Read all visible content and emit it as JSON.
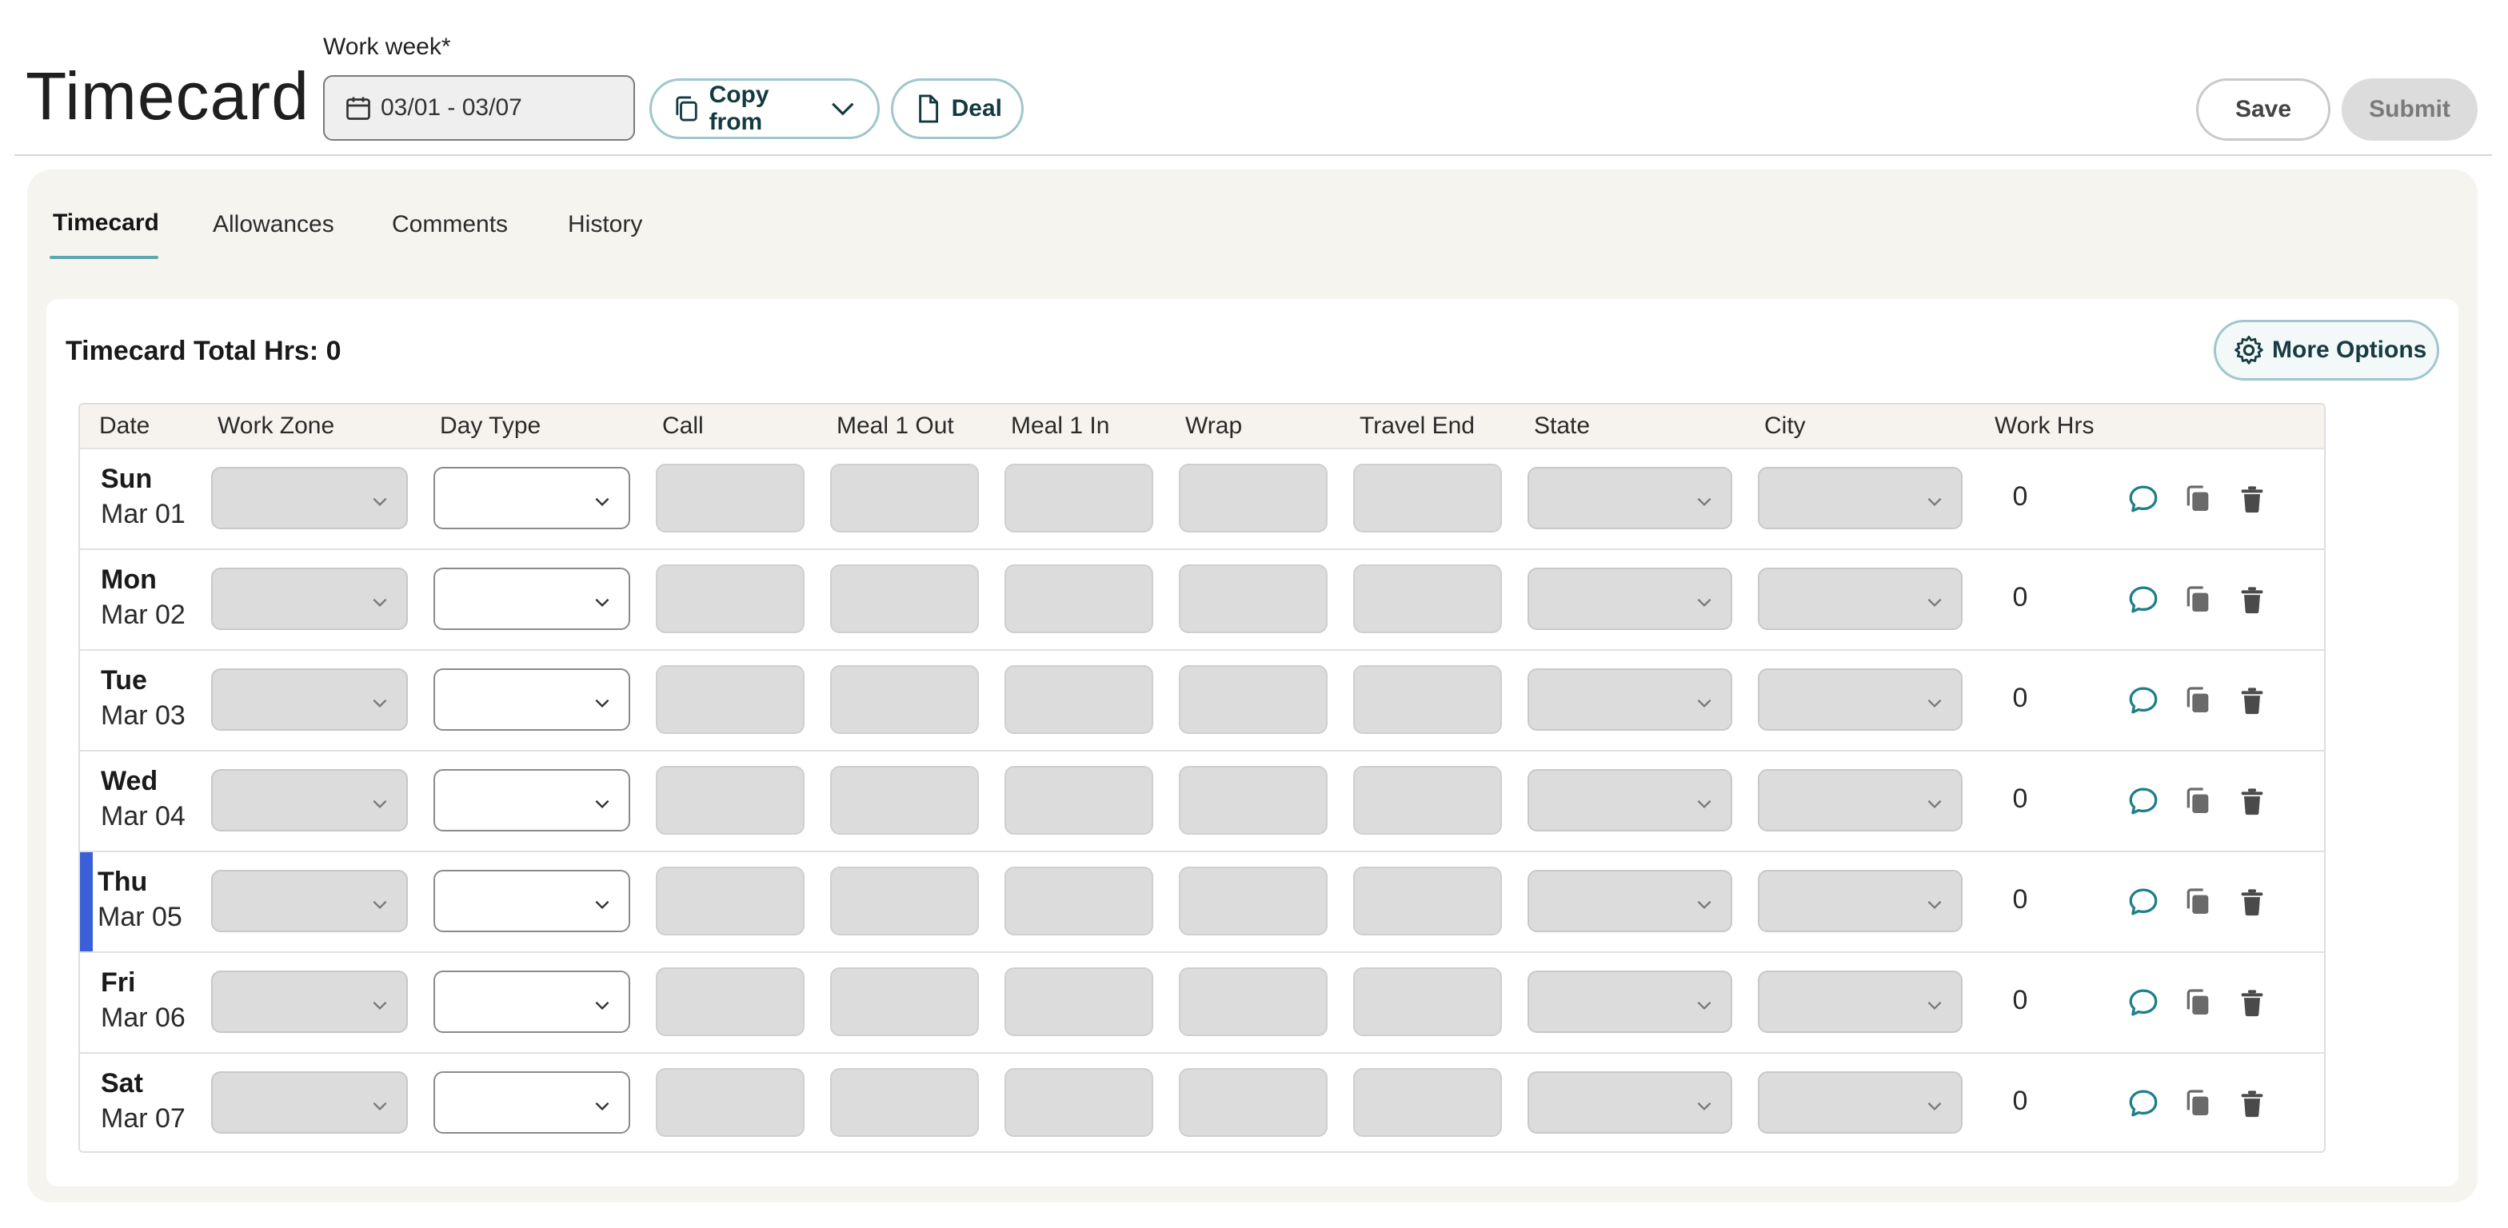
{
  "header": {
    "title": "Timecard",
    "work_week_label": "Work week*",
    "work_week_value": "03/01 - 03/07",
    "copy_from_label": "Copy from",
    "deal_label": "Deal",
    "save_label": "Save",
    "submit_label": "Submit"
  },
  "tabs": [
    {
      "label": "Timecard",
      "active": true
    },
    {
      "label": "Allowances",
      "active": false
    },
    {
      "label": "Comments",
      "active": false
    },
    {
      "label": "History",
      "active": false
    }
  ],
  "card": {
    "total_label": "Timecard Total Hrs: 0",
    "more_options_label": "More Options"
  },
  "table": {
    "columns": [
      "Date",
      "Work Zone",
      "Day Type",
      "Call",
      "Meal 1 Out",
      "Meal 1 In",
      "Wrap",
      "Travel End",
      "State",
      "City",
      "Work Hrs"
    ],
    "rows": [
      {
        "day": "Sun",
        "date": "Mar 01",
        "work_hrs": "0",
        "today": false
      },
      {
        "day": "Mon",
        "date": "Mar 02",
        "work_hrs": "0",
        "today": false
      },
      {
        "day": "Tue",
        "date": "Mar 03",
        "work_hrs": "0",
        "today": false
      },
      {
        "day": "Wed",
        "date": "Mar 04",
        "work_hrs": "0",
        "today": false
      },
      {
        "day": "Thu",
        "date": "Mar 05",
        "work_hrs": "0",
        "today": true
      },
      {
        "day": "Fri",
        "date": "Mar 06",
        "work_hrs": "0",
        "today": false
      },
      {
        "day": "Sat",
        "date": "Mar 07",
        "work_hrs": "0",
        "today": false
      }
    ]
  },
  "colors": {
    "accent": "#5fa7b0",
    "today_marker": "#3b5fd6",
    "comment_icon": "#1e7f8a"
  },
  "icons": {
    "calendar": "calendar-icon",
    "copy": "copy-icon",
    "document": "document-icon",
    "gear": "gear-icon",
    "comment": "comment-icon",
    "duplicate": "duplicate-icon",
    "trash": "trash-icon"
  }
}
